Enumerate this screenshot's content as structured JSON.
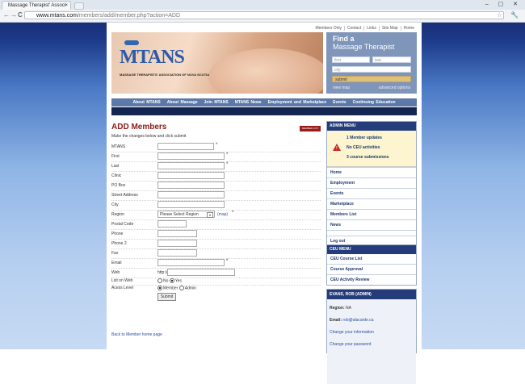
{
  "browser": {
    "tab_title": "Massage Therapist' Associ",
    "tab_close": "×",
    "window_controls": "– ▢ ✕",
    "url_host": "www.mtans.com",
    "url_path": "/members/add/member.php?action=ADD",
    "back_glyph": "←",
    "forward_glyph": "→",
    "reload_glyph": "C",
    "star_glyph": "☆",
    "wrench_glyph": "🔧"
  },
  "top_links": [
    "Members Only",
    "Contact",
    "Links",
    "Site Map",
    "Home"
  ],
  "logo": {
    "text": "MTANS",
    "subtitle": "MASSAGE THERAPISTS' ASSOCIATION OF NOVA SCOTIA"
  },
  "find": {
    "title": "Find a",
    "subtitle": "Massage Therapist",
    "first_placeholder": "first",
    "last_placeholder": "last",
    "city_placeholder": "city",
    "submit": "submit",
    "view_map": "view map",
    "advanced": "advanced options"
  },
  "main_nav": [
    "About MTANS",
    "About Massage",
    "Join MTANS",
    "MTANS News",
    "Employment and Marketplace",
    "Events",
    "Continuing Education"
  ],
  "form": {
    "title": "ADD Members",
    "members_button": "MEMBER LIST",
    "subtitle": "Make the changes below and click submit",
    "labels": {
      "mtans": "MTANS",
      "first": "First",
      "last": "Last",
      "clinic": "Clinic",
      "po_box": "PO Box",
      "street": "Street Address",
      "city": "City",
      "region": "Region",
      "postal": "Postal Code",
      "phone": "Phone",
      "phone2": "Phone 2",
      "fax": "Fax",
      "email": "Email",
      "web": "Web",
      "list_on_web": "List on Web",
      "access_level": "Acess Level"
    },
    "required_mark": "*",
    "region_value": "Please Select Region",
    "region_dd": "▾",
    "map_link": "(map)",
    "web_prefix": "http://",
    "list_on_web_no": "No",
    "list_on_web_yes": "Yes",
    "access_member": "Member",
    "access_admin": "Admin",
    "submit": "Submit",
    "back_link": "Back to Member home page"
  },
  "admin_menu": {
    "title": "ADMIN MENU",
    "alerts": [
      "1 Member updates",
      "No CEU activities",
      "3 course submissions"
    ],
    "warn_mark": "!",
    "items": [
      "Home",
      "Employment",
      "Events",
      "Marketplace",
      "Members List",
      "News"
    ],
    "logout": "Log out"
  },
  "ceu_menu": {
    "title": "CEU MENU",
    "items": [
      "CEU Course List",
      "Course Approval",
      "CEU Activity Review"
    ]
  },
  "user": {
    "title": "EVANS, ROB (ADMIN)",
    "region_label": "Region:",
    "region_value": "NA",
    "email_label": "Email:",
    "email_value": "rob@alacarde.ca",
    "change_info": "Change your information",
    "change_password": "Change your password"
  }
}
